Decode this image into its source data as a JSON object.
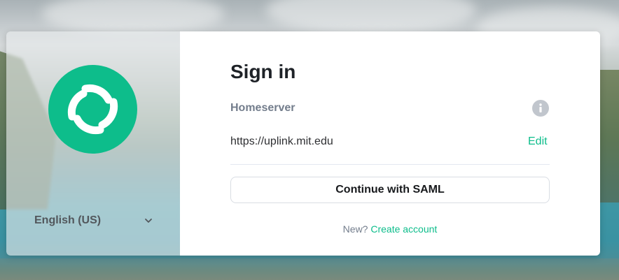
{
  "left_panel": {
    "logo_icon": "element-logo-icon",
    "logo_color": "#0dbd8b",
    "language": {
      "selected": "English (US)",
      "icon": "chevron-down-icon"
    }
  },
  "signin": {
    "title": "Sign in",
    "homeserver_label": "Homeserver",
    "info_icon": "info-icon",
    "homeserver_url": "https://uplink.mit.edu",
    "edit_label": "Edit",
    "saml_button_label": "Continue with SAML",
    "new_prompt": "New?",
    "create_account_label": "Create account"
  },
  "colors": {
    "accent": "#0dbd8b",
    "muted_text": "#737d8c",
    "heading": "#1e2227"
  }
}
